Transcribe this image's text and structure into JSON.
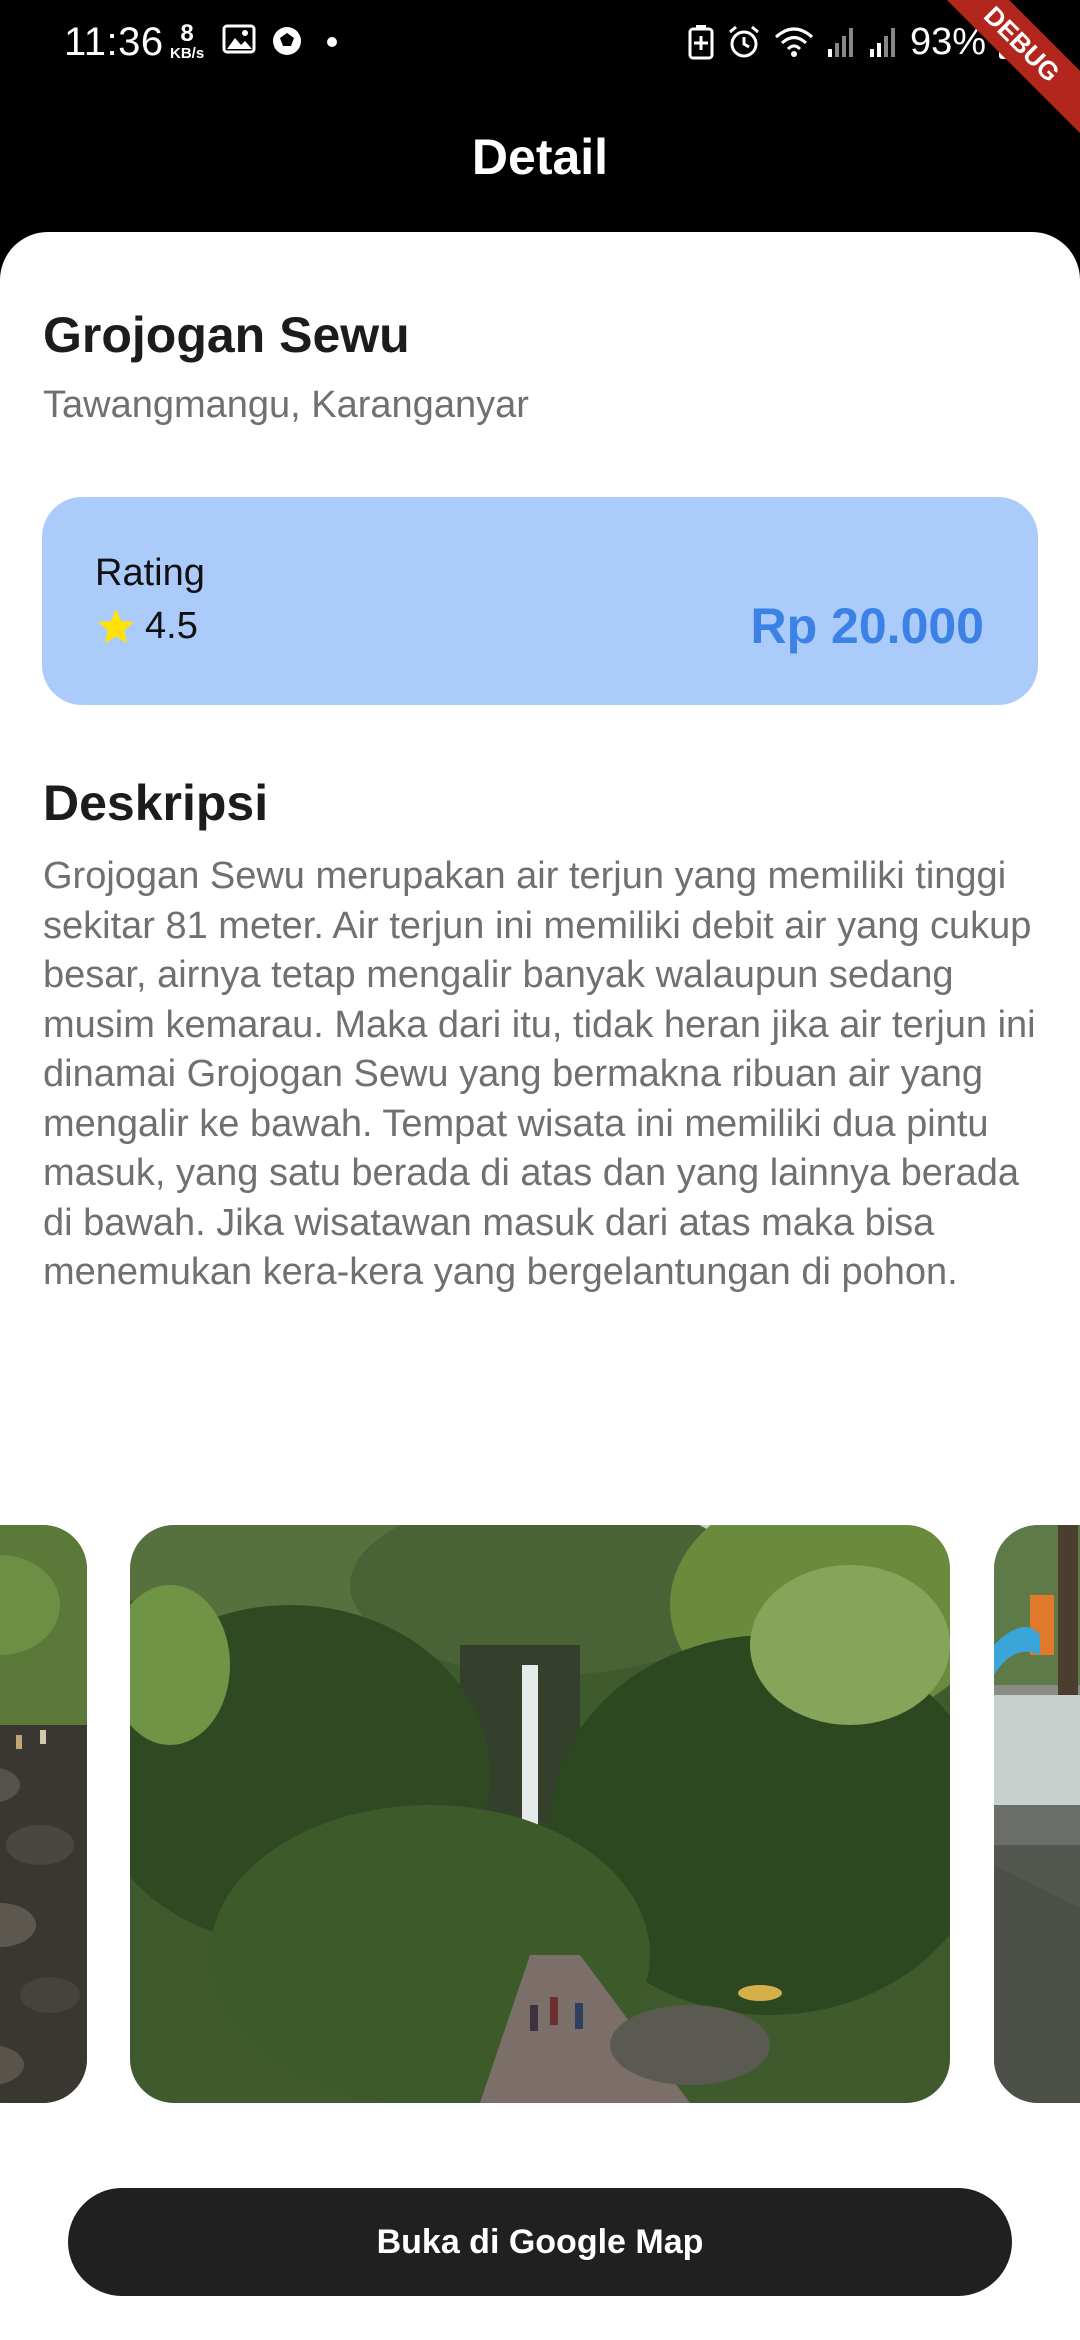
{
  "status_bar": {
    "time": "11:36",
    "net_speed_value": "8",
    "net_speed_unit": "KB/s",
    "battery_percent": "93%"
  },
  "debug_banner": "DEBUG",
  "app_bar": {
    "title": "Detail"
  },
  "place": {
    "name": "Grojogan Sewu",
    "location": "Tawangmangu, Karanganyar"
  },
  "info_card": {
    "rating_label": "Rating",
    "rating_value": "4.5",
    "price": "Rp 20.000"
  },
  "description": {
    "title": "Deskripsi",
    "text": "Grojogan Sewu merupakan air terjun yang memiliki tinggi sekitar 81 meter. Air terjun ini memiliki debit air yang cukup besar, airnya tetap mengalir banyak walaupun sedang musim kemarau. Maka dari itu, tidak heran jika air terjun ini dinamai Grojogan Sewu yang bermakna ribuan air yang mengalir ke bawah. Tempat wisata ini memiliki dua pintu masuk, yang satu berada di atas dan yang lainnya berada di bawah. Jika wisatawan masuk dari atas maka bisa menemukan kera-kera yang bergelantungan di pohon."
  },
  "button": {
    "label": "Buka di Google Map"
  },
  "colors": {
    "card_bg": "#abcbfb",
    "price": "#3c82e6",
    "button_bg": "#202020",
    "star": "#ffe20a"
  }
}
